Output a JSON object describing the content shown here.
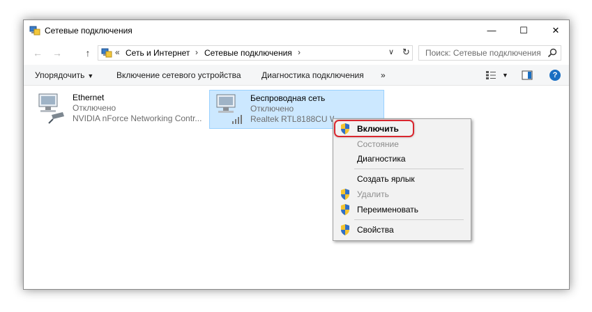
{
  "window": {
    "title": "Сетевые подключения",
    "controls": {
      "minimize": "—",
      "maximize": "☐",
      "close": "✕"
    }
  },
  "address": {
    "back": "←",
    "forward": "→",
    "up": "↑",
    "overflow": "«",
    "crumbs": [
      "Сеть и Интернет",
      "Сетевые подключения"
    ],
    "separator": "›",
    "dropdown": "∨",
    "refresh": "↻"
  },
  "search": {
    "placeholder": "Поиск: Сетевые подключения"
  },
  "toolbar": {
    "organize": "Упорядочить",
    "organize_caret": "▼",
    "enable_device": "Включение сетевого устройства",
    "diagnose": "Диагностика подключения",
    "more": "»",
    "view_caret": "▼",
    "help": "?"
  },
  "connections": [
    {
      "name": "Ethernet",
      "status": "Отключено",
      "device": "NVIDIA nForce Networking Contr..."
    },
    {
      "name": "Беспроводная сеть",
      "status": "Отключено",
      "device": "Realtek RTL8188CU Wireless LAN"
    }
  ],
  "context_menu": {
    "items": [
      {
        "label": "Включить",
        "shield": true
      },
      {
        "label": "Состояние"
      },
      {
        "label": "Диагностика"
      },
      {
        "label": "Создать ярлык"
      },
      {
        "label": "Удалить",
        "shield": true
      },
      {
        "label": "Переименовать",
        "shield": true
      },
      {
        "label": "Свойства",
        "shield": true
      }
    ]
  },
  "colors": {
    "selection": "#cce8ff",
    "highlight_ring": "#d9262e",
    "help_blue": "#1a6fc2"
  }
}
